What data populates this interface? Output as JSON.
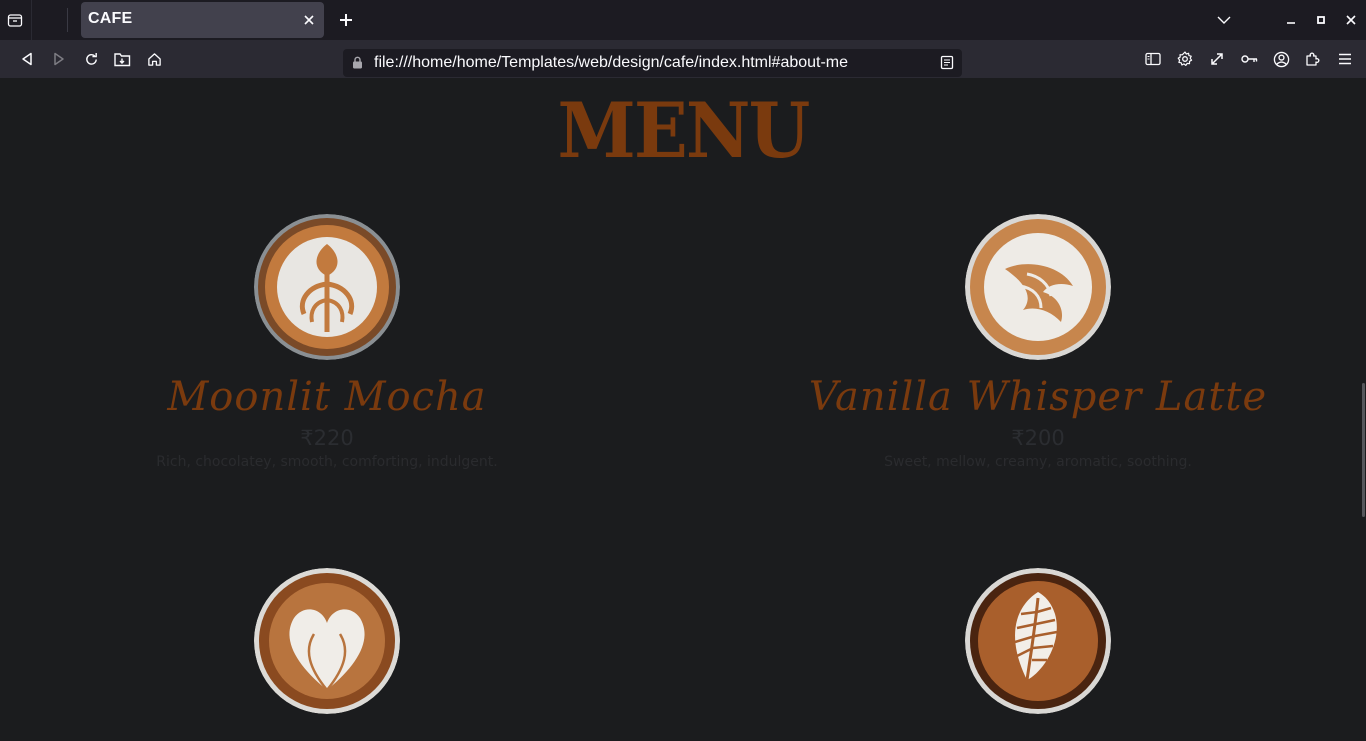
{
  "browser": {
    "tab_title": "CAFE",
    "url": "file:///home/home/Templates/web/design/cafe/index.html#about-me"
  },
  "page": {
    "menu_heading": "MENU",
    "items": [
      {
        "name": "Moonlit Mocha",
        "price": "₹220",
        "description": "Rich, chocolatey, smooth, comforting, indulgent."
      },
      {
        "name": "Vanilla Whisper Latte",
        "price": "₹200",
        "description": "Sweet, mellow, creamy, aromatic, soothing."
      },
      {
        "name": "",
        "price": "",
        "description": ""
      },
      {
        "name": "",
        "price": "",
        "description": ""
      }
    ]
  },
  "colors": {
    "accent_brown": "#7a3a0e",
    "page_bg": "#1b1c1e",
    "chrome_bg": "#2b2a33",
    "tab_active": "#42414d"
  },
  "icons": {
    "tab_overview": "tab-overview-icon",
    "close": "close-icon",
    "new_tab": "plus-icon",
    "list_tabs": "chevron-down-icon",
    "back": "back-arrow-icon",
    "forward": "forward-arrow-icon",
    "reload": "reload-icon",
    "save": "save-to-pocket-icon",
    "home": "home-icon",
    "lock": "lock-icon",
    "reader": "reader-view-icon",
    "sidebar": "sidebar-icon",
    "settings": "gear-icon",
    "fullscreen": "expand-icon",
    "passwords": "key-icon",
    "account": "account-icon",
    "extensions": "puzzle-icon",
    "menu": "hamburger-menu-icon"
  }
}
